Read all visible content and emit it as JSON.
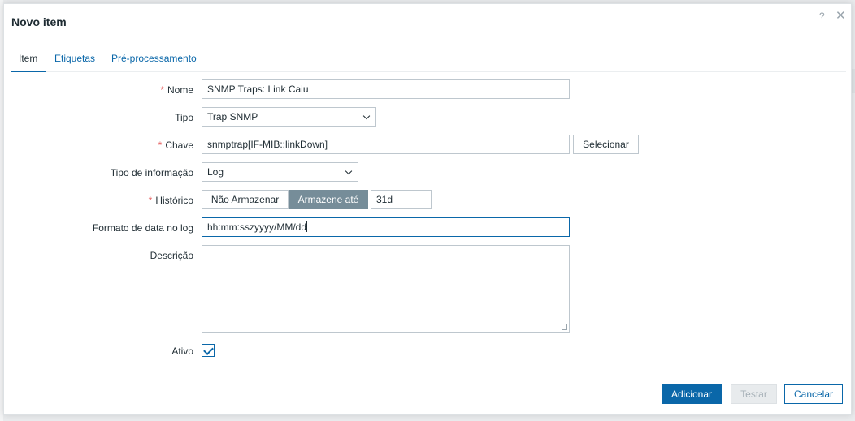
{
  "dialog": {
    "title": "Novo item",
    "help_icon": "question-mark-icon",
    "close_icon": "close-icon"
  },
  "tabs": [
    {
      "label": "Item",
      "active": true
    },
    {
      "label": "Etiquetas",
      "active": false
    },
    {
      "label": "Pré-processamento",
      "active": false
    }
  ],
  "form": {
    "nome": {
      "label": "Nome",
      "required": true,
      "value": "SNMP Traps: Link Caiu"
    },
    "tipo": {
      "label": "Tipo",
      "value": "Trap SNMP"
    },
    "chave": {
      "label": "Chave",
      "required": true,
      "value": "snmptrap[IF-MIB::linkDown]",
      "select_button": "Selecionar"
    },
    "tipo_informacao": {
      "label": "Tipo de informação",
      "value": "Log"
    },
    "historico": {
      "label": "Histórico",
      "required": true,
      "option_off": "Não Armazenar",
      "option_on": "Armazene até",
      "value": "31d"
    },
    "formato_data": {
      "label": "Formato de data no log",
      "value": "hh:mm:sszyyyy/MM/dd"
    },
    "descricao": {
      "label": "Descrição",
      "value": ""
    },
    "ativo": {
      "label": "Ativo",
      "checked": true
    }
  },
  "footer": {
    "add_label": "Adicionar",
    "test_label": "Testar",
    "cancel_label": "Cancelar"
  },
  "colors": {
    "accent": "#0a67a9",
    "required": "#e45959",
    "toggle_active": "#768d99"
  }
}
